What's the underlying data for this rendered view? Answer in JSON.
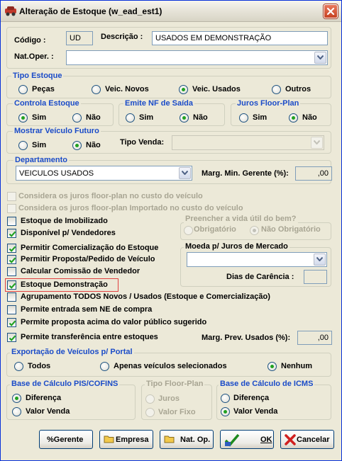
{
  "window": {
    "title": "Alteração de Estoque (w_ead_est1)"
  },
  "header": {
    "codigo_label": "Código :",
    "codigo_value": "UD",
    "descricao_label": "Descrição :",
    "descricao_value": "USADOS EM DEMONSTRAÇÃO",
    "natoper_label": "Nat.Oper. :",
    "natoper_value": ""
  },
  "tipo_estoque": {
    "title": "Tipo Estoque",
    "options": [
      "Peças",
      "Veic. Novos",
      "Veic. Usados",
      "Outros"
    ],
    "selected": "Veic. Usados"
  },
  "controla_estoque": {
    "title": "Controla Estoque",
    "options": [
      "Sim",
      "Não"
    ],
    "selected": "Sim"
  },
  "emite_nf": {
    "title": "Emite NF de Saída",
    "options": [
      "Sim",
      "Não"
    ],
    "selected": "Não"
  },
  "juros_floor": {
    "title": "Juros Floor-Plan",
    "options": [
      "Sim",
      "Não"
    ],
    "selected": "Não"
  },
  "mostrar_veiculo": {
    "title": "Mostrar Veículo Futuro",
    "options": [
      "Sim",
      "Não"
    ],
    "selected": "Não"
  },
  "tipo_venda": {
    "label": "Tipo Venda:",
    "value": ""
  },
  "departamento": {
    "title": "Departamento",
    "value": "VEICULOS USADOS",
    "margem_label": "Marg. Min. Gerente (%):",
    "margem_value": ",00"
  },
  "checkboxes": [
    {
      "label": "Considera os juros floor-plan no custo do veículo",
      "checked": false,
      "enabled": false
    },
    {
      "label": "Considera os juros floor-plan Importado no custo do veículo",
      "checked": false,
      "enabled": false
    },
    {
      "label": "Estoque de Imobilizado",
      "checked": false,
      "enabled": true
    },
    {
      "label": "Disponível p/ Vendedores",
      "checked": true,
      "enabled": true
    },
    {
      "label": "Permitir Comercialização do Estoque",
      "checked": true,
      "enabled": true
    },
    {
      "label": "Permitir Proposta/Pedido de Veículo",
      "checked": true,
      "enabled": true
    },
    {
      "label": "Calcular Comissão de Vendedor",
      "checked": false,
      "enabled": true
    },
    {
      "label": "Estoque Demonstração",
      "checked": true,
      "enabled": true
    },
    {
      "label": "Agrupamento TODOS Novos / Usados (Estoque e Comercialização)",
      "checked": false,
      "enabled": true
    },
    {
      "label": "Permite entrada sem NE de compra",
      "checked": false,
      "enabled": true
    },
    {
      "label": "Permite proposta acima do valor público sugerido",
      "checked": true,
      "enabled": true
    },
    {
      "label": "Permite transferência entre estoques",
      "checked": true,
      "enabled": true
    }
  ],
  "vida_util": {
    "title": "Preencher a vida útil do bem?",
    "options": [
      "Obrigatório",
      "Não Obrigatório"
    ],
    "selected": "Não Obrigatório"
  },
  "moeda": {
    "title": "Moeda p/ Juros de Mercado",
    "value": "",
    "dias_label": "Dias de Carência :",
    "dias_value": ""
  },
  "marg_prev": {
    "label": "Marg. Prev. Usados (%):",
    "value": ",00"
  },
  "exportacao": {
    "title": "Exportação de Veículos p/ Portal",
    "options": [
      "Todos",
      "Apenas veículos selecionados",
      "Nenhum"
    ],
    "selected": "Nenhum"
  },
  "pis_cofins": {
    "title": "Base de Cálculo PIS/COFINS",
    "options": [
      "Diferença",
      "Valor Venda"
    ],
    "selected": "Diferença"
  },
  "tipo_floor": {
    "title": "Tipo Floor-Plan",
    "options": [
      "Juros",
      "Valor Fixo"
    ],
    "selected": ""
  },
  "icms": {
    "title": "Base de Cálculo de ICMS",
    "options": [
      "Diferença",
      "Valor Venda"
    ],
    "selected": "Valor Venda"
  },
  "buttons": {
    "gerente": "%Gerente",
    "empresa": "Empresa",
    "natop": "Nat. Op.",
    "ok": "OK",
    "cancelar": "Cancelar"
  },
  "colors": {
    "group_title": "#1A4BC8",
    "window_bg": "#ECE9D8",
    "highlight_border": "#E04040"
  }
}
